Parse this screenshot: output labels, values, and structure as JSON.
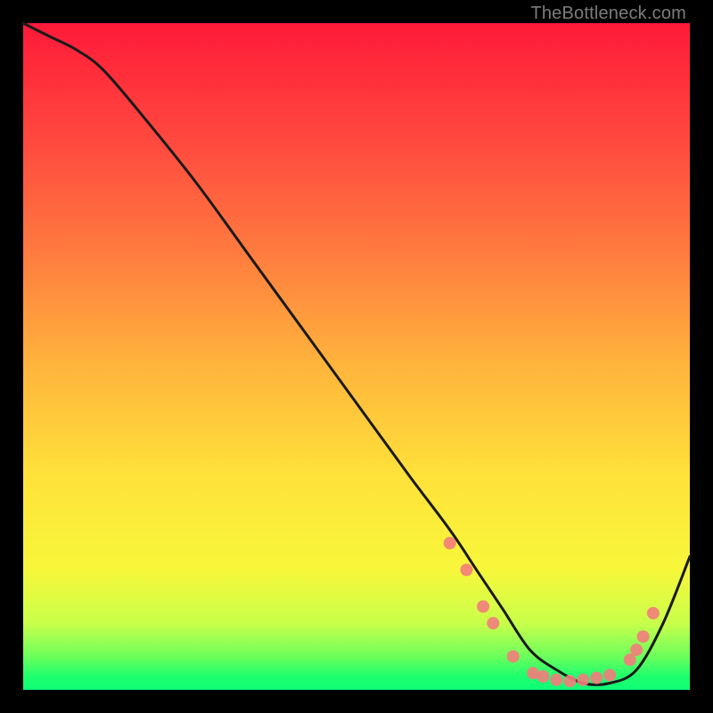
{
  "watermark": "TheBottleneck.com",
  "chart_data": {
    "type": "line",
    "title": "",
    "xlabel": "",
    "ylabel": "",
    "xlim": [
      0,
      100
    ],
    "ylim": [
      0,
      100
    ],
    "series": [
      {
        "name": "curve",
        "x": [
          0,
          4,
          8,
          12,
          18,
          26,
          34,
          42,
          50,
          58,
          64,
          68,
          72,
          76,
          80,
          84,
          88,
          92,
          96,
          100
        ],
        "y": [
          100,
          98,
          96,
          93,
          86,
          76,
          65,
          54,
          43,
          32,
          24,
          18,
          12,
          6,
          3,
          1,
          1,
          3,
          10,
          20
        ]
      }
    ],
    "markers": [
      {
        "x": 64.0,
        "y": 22.0
      },
      {
        "x": 66.5,
        "y": 18.0
      },
      {
        "x": 69.0,
        "y": 12.5
      },
      {
        "x": 70.5,
        "y": 10.0
      },
      {
        "x": 73.5,
        "y": 5.0
      },
      {
        "x": 76.5,
        "y": 2.5
      },
      {
        "x": 78.0,
        "y": 2.0
      },
      {
        "x": 80.0,
        "y": 1.5
      },
      {
        "x": 82.0,
        "y": 1.3
      },
      {
        "x": 84.0,
        "y": 1.5
      },
      {
        "x": 86.0,
        "y": 1.8
      },
      {
        "x": 88.0,
        "y": 2.2
      },
      {
        "x": 91.0,
        "y": 4.5
      },
      {
        "x": 92.0,
        "y": 6.0
      },
      {
        "x": 93.0,
        "y": 8.0
      },
      {
        "x": 94.5,
        "y": 11.5
      }
    ],
    "marker_color": "#f47c7c",
    "curve_color": "#1a1a1a"
  }
}
